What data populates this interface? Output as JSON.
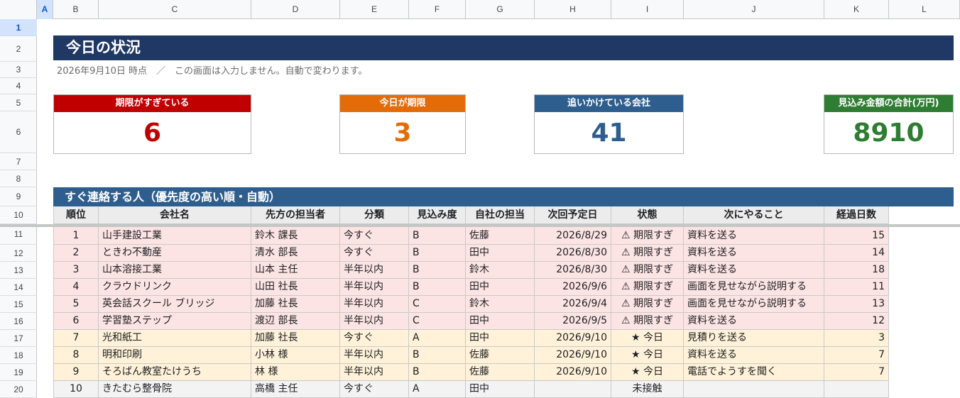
{
  "sheet": {
    "columns": [
      "A",
      "B",
      "C",
      "D",
      "E",
      "F",
      "G",
      "H",
      "I",
      "J",
      "K",
      "L"
    ],
    "selected_column": "A",
    "rows": [
      "1",
      "2",
      "3",
      "4",
      "5",
      "6",
      "7",
      "8",
      "9",
      "10",
      "11",
      "12",
      "13",
      "14",
      "15",
      "16",
      "17",
      "18",
      "19",
      "20"
    ],
    "selected_row": "1"
  },
  "header": {
    "title": "今日の状況",
    "subtitle": "2026年9月10日 時点　／　この画面は入力しません。自動で変わります。"
  },
  "kpis": [
    {
      "label": "期限がすぎている",
      "value": "6",
      "header_color": "#c00000",
      "value_color": "#c00000"
    },
    {
      "label": "今日が期限",
      "value": "3",
      "header_color": "#e36c09",
      "value_color": "#e36c09"
    },
    {
      "label": "追いかけている会社",
      "value": "41",
      "header_color": "#2e5e8e",
      "value_color": "#2e5e8e"
    },
    {
      "label": "見込み金額の合計(万円)",
      "value": "8910",
      "header_color": "#2e7d32",
      "value_color": "#2e7d32"
    }
  ],
  "section": {
    "title": "すぐ連絡する人（優先度の高い順・自動）"
  },
  "table": {
    "columns": [
      "順位",
      "会社名",
      "先方の担当者",
      "分類",
      "見込み度",
      "自社の担当",
      "次回予定日",
      "状態",
      "次にやること",
      "経過日数"
    ],
    "row_colors": {
      "overdue": "#fce4e4",
      "today": "#fff2d9",
      "none": "#f3f3f3"
    },
    "rows": [
      {
        "rank": "1",
        "company": "山手建設工業",
        "contact": "鈴木 課長",
        "category": "今すぐ",
        "likelihood": "B",
        "owner": "佐藤",
        "next_date": "2026/8/29",
        "status": "⚠ 期限すぎ",
        "next_action": "資料を送る",
        "days": "15",
        "kind": "overdue"
      },
      {
        "rank": "2",
        "company": "ときわ不動産",
        "contact": "清水 部長",
        "category": "今すぐ",
        "likelihood": "B",
        "owner": "田中",
        "next_date": "2026/8/30",
        "status": "⚠ 期限すぎ",
        "next_action": "資料を送る",
        "days": "14",
        "kind": "overdue"
      },
      {
        "rank": "3",
        "company": "山本溶接工業",
        "contact": "山本 主任",
        "category": "半年以内",
        "likelihood": "B",
        "owner": "鈴木",
        "next_date": "2026/8/30",
        "status": "⚠ 期限すぎ",
        "next_action": "資料を送る",
        "days": "18",
        "kind": "overdue"
      },
      {
        "rank": "4",
        "company": "クラウドリンク",
        "contact": "山田 社長",
        "category": "半年以内",
        "likelihood": "B",
        "owner": "田中",
        "next_date": "2026/9/6",
        "status": "⚠ 期限すぎ",
        "next_action": "画面を見せながら説明する",
        "days": "11",
        "kind": "overdue"
      },
      {
        "rank": "5",
        "company": "英会話スクール ブリッジ",
        "contact": "加藤 社長",
        "category": "半年以内",
        "likelihood": "C",
        "owner": "鈴木",
        "next_date": "2026/9/4",
        "status": "⚠ 期限すぎ",
        "next_action": "画面を見せながら説明する",
        "days": "13",
        "kind": "overdue"
      },
      {
        "rank": "6",
        "company": "学習塾ステップ",
        "contact": "渡辺 部長",
        "category": "半年以内",
        "likelihood": "C",
        "owner": "田中",
        "next_date": "2026/9/5",
        "status": "⚠ 期限すぎ",
        "next_action": "資料を送る",
        "days": "12",
        "kind": "overdue"
      },
      {
        "rank": "7",
        "company": "光和紙工",
        "contact": "加藤 社長",
        "category": "今すぐ",
        "likelihood": "A",
        "owner": "田中",
        "next_date": "2026/9/10",
        "status": "★ 今日",
        "next_action": "見積りを送る",
        "days": "3",
        "kind": "today"
      },
      {
        "rank": "8",
        "company": "明和印刷",
        "contact": "小林 様",
        "category": "半年以内",
        "likelihood": "B",
        "owner": "佐藤",
        "next_date": "2026/9/10",
        "status": "★ 今日",
        "next_action": "資料を送る",
        "days": "7",
        "kind": "today"
      },
      {
        "rank": "9",
        "company": "そろばん教室たけうち",
        "contact": "林 様",
        "category": "半年以内",
        "likelihood": "B",
        "owner": "佐藤",
        "next_date": "2026/9/10",
        "status": "★ 今日",
        "next_action": "電話でようすを聞く",
        "days": "7",
        "kind": "today"
      },
      {
        "rank": "10",
        "company": "きたむら整骨院",
        "contact": "高橋 主任",
        "category": "今すぐ",
        "likelihood": "A",
        "owner": "田中",
        "next_date": "",
        "status": "未接触",
        "next_action": "",
        "days": "",
        "kind": "none"
      }
    ]
  }
}
